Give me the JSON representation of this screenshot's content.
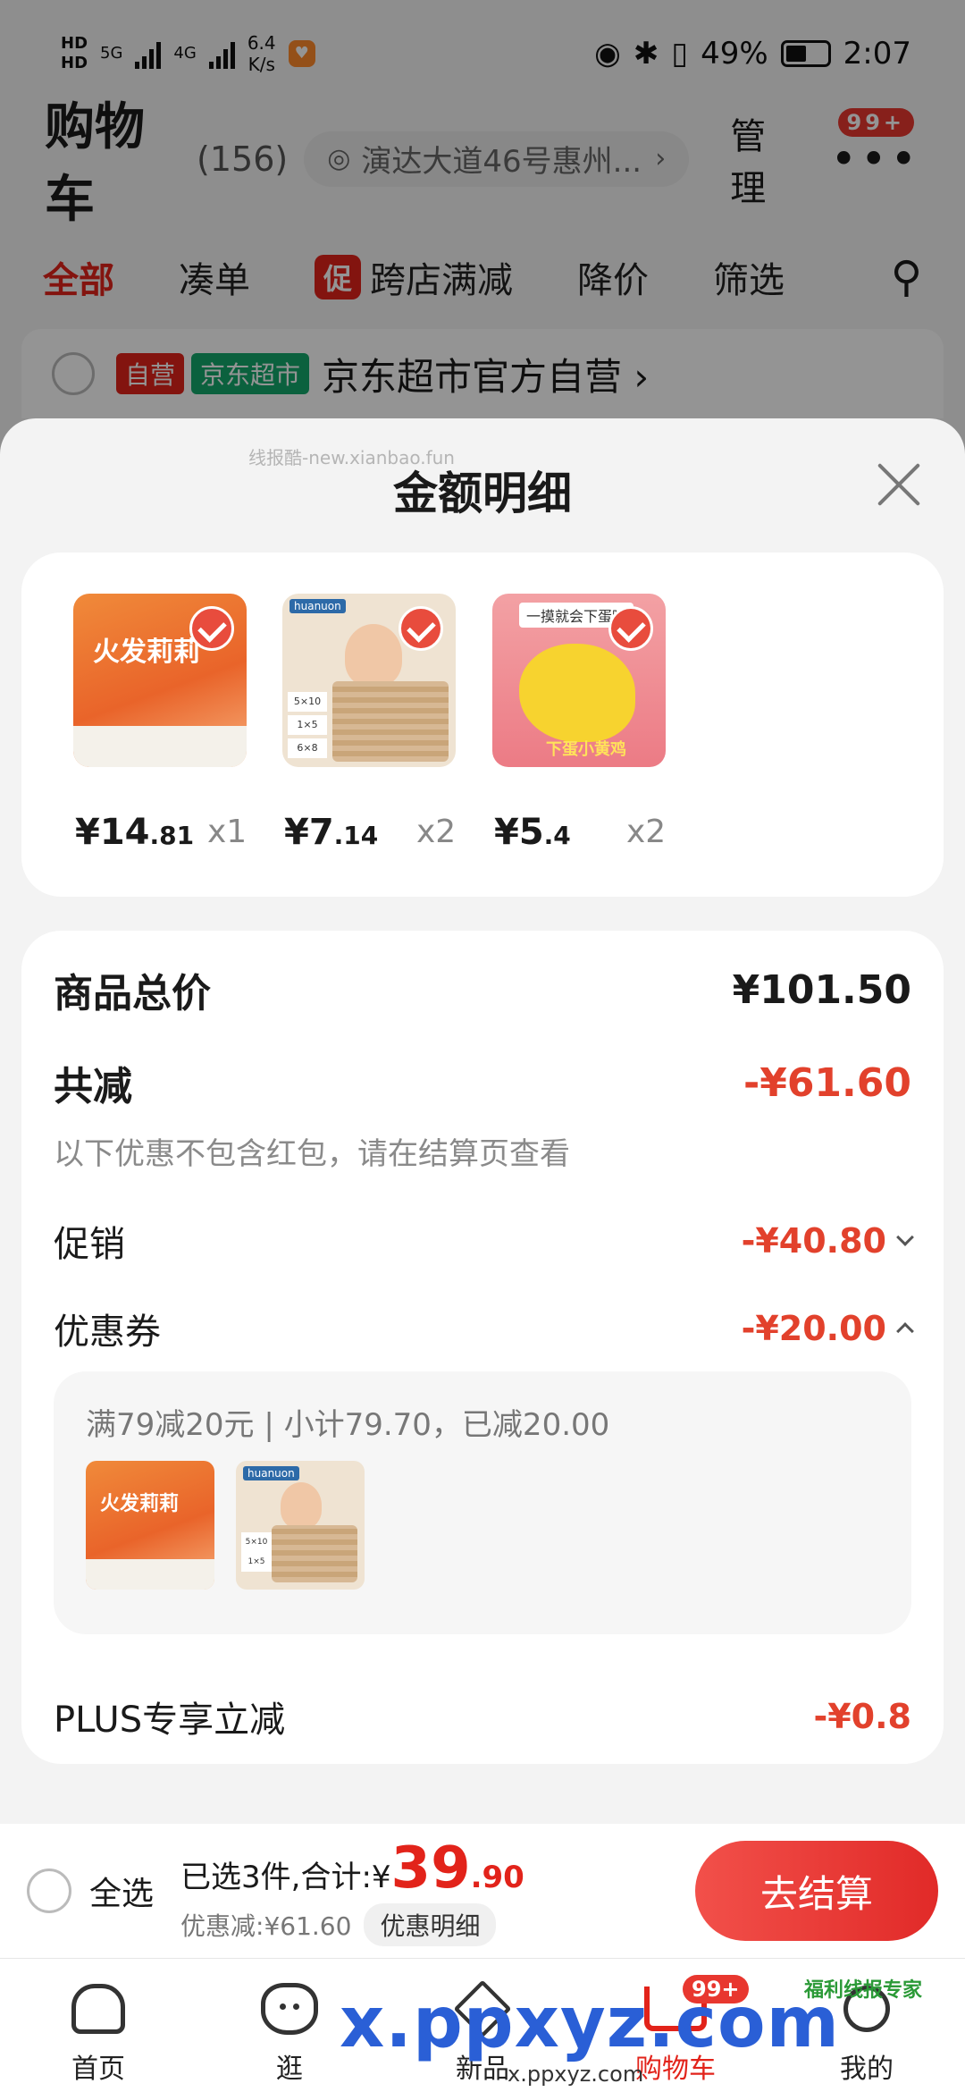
{
  "status_bar": {
    "hd1": "HD",
    "hd2": "HD",
    "net1": "5G",
    "net2": "4G",
    "speed_value": "6.4",
    "speed_unit": "K/s",
    "battery": "49%",
    "time": "2:07"
  },
  "cart_header": {
    "title": "购物车",
    "count": "(156)",
    "address": "演达大道46号惠州...",
    "manage": "管理",
    "badge": "99+"
  },
  "cart_tabs": [
    {
      "label": "全部"
    },
    {
      "label": "凑单"
    },
    {
      "label": "跨店满减",
      "tag": "促"
    },
    {
      "label": "降价"
    },
    {
      "label": "筛选"
    }
  ],
  "store": {
    "tag_self": "自营",
    "tag_market": "京东超市",
    "name": "京东超市官方自营 ›"
  },
  "sheet": {
    "watermark": "线报酷-new.xianbao.fun",
    "title": "金额明细",
    "products": [
      {
        "price_int": "¥14",
        "price_dec": ".81",
        "qty": "x1",
        "thumb_text": "火发莉莉"
      },
      {
        "price_int": "¥7",
        "price_dec": ".14",
        "qty": "x2",
        "thumb_text": "huanuon"
      },
      {
        "price_int": "¥5",
        "price_dec": ".4",
        "qty": "x2",
        "thumb_text": "一摸就会下蛋哦",
        "thumb_text2": "下蛋小黄鸡"
      }
    ],
    "summary": {
      "total_label": "商品总价",
      "total_value": "¥101.50",
      "reduce_label": "共减",
      "reduce_value": "-¥61.60",
      "note": "以下优惠不包含红包，请在结算页查看",
      "promo_label": "促销",
      "promo_value": "-¥40.80",
      "coupon_label": "优惠券",
      "coupon_value": "-¥20.00",
      "coupon_detail": "满79减20元 | 小计79.70，已减20.00",
      "plus_label": "PLUS专享立减",
      "plus_value": "-¥0.8"
    }
  },
  "checkout": {
    "select_all": "全选",
    "selected_text": "已选3件,合计:¥",
    "total_int": "39",
    "total_dec": ".90",
    "discount_text": "优惠减:¥61.60",
    "detail_button": "优惠明细",
    "checkout_button": "去结算"
  },
  "bottom_nav": [
    {
      "label": "首页",
      "icon": "home-icon"
    },
    {
      "label": "逛",
      "icon": "discover-icon"
    },
    {
      "label": "新品",
      "icon": "box-icon"
    },
    {
      "label": "购物车",
      "icon": "cart-icon",
      "badge": "99+"
    },
    {
      "label": "我的",
      "icon": "profile-icon"
    }
  ],
  "watermark_bottom": {
    "big": "x.ppxyz.com",
    "small": "x.ppxyz.com",
    "logo": "福利线报专家"
  },
  "colors": {
    "accent_red": "#e2231a",
    "price_red": "#e2412c",
    "market_green": "#14a86b"
  }
}
